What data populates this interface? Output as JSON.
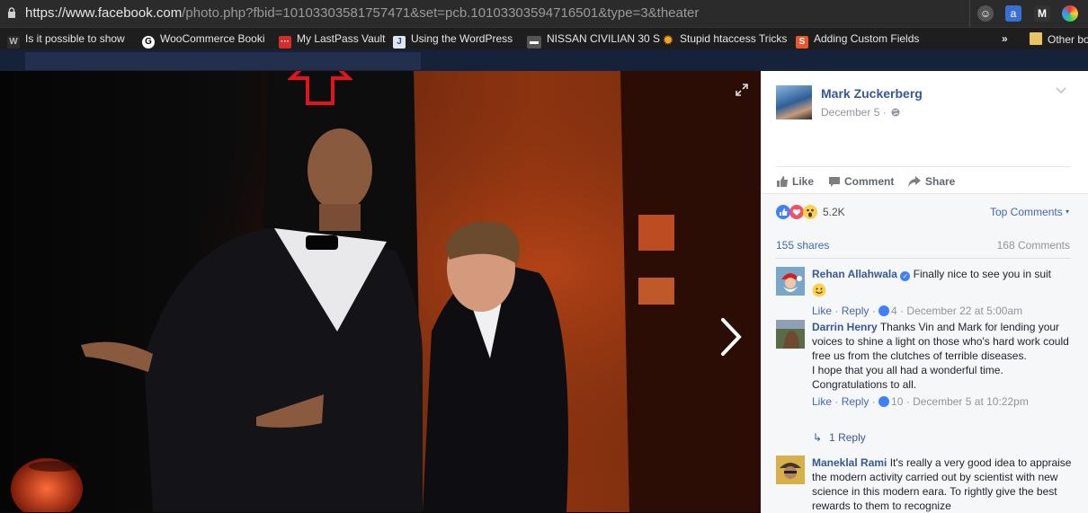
{
  "browser": {
    "url_host": "https://www.facebook.com",
    "url_path": "/photo.php?fbid=10103303581757471&set=pcb.10103303594716501&type=3&theater",
    "bookmarks": [
      {
        "label": "Is it possible to show",
        "icon": "wordpress-icon"
      },
      {
        "label": "WooCommerce Booki",
        "icon": "github-icon"
      },
      {
        "label": "My LastPass Vault",
        "icon": "lastpass-icon"
      },
      {
        "label": "Using the WordPress",
        "icon": "j-doc-icon"
      },
      {
        "label": "NISSAN CIVILIAN 30 S",
        "icon": "nissan-icon"
      },
      {
        "label": "Stupid htaccess Tricks",
        "icon": "sun-icon"
      },
      {
        "label": "Adding Custom Fields",
        "icon": "s-icon"
      },
      {
        "label": "»",
        "icon": "more-icon"
      },
      {
        "label": "Other bo",
        "icon": "folder-icon"
      }
    ]
  },
  "post": {
    "author": "Mark Zuckerberg",
    "date": "December 5 ·",
    "actions": {
      "like": "Like",
      "comment": "Comment",
      "share": "Share"
    },
    "reaction_count": "5.2K",
    "top_comments": "Top Comments",
    "shares": "155 shares",
    "comment_count": "168 Comments"
  },
  "comments": [
    {
      "author": "Rehan Allahwala",
      "text": "Finally nice to see you in suit",
      "like": "Like",
      "reply": "Reply",
      "likes": "4",
      "time": "December 22 at 5:00am"
    },
    {
      "author": "Darrin Henry",
      "text": "Thanks Vin and Mark for lending your voices to shine a light on those who's hard work could free us from the clutches of terrible diseases.",
      "text2": "I hope that you all had a wonderful time.",
      "text3": "Congratulations to all.",
      "like": "Like",
      "reply": "Reply",
      "likes": "10",
      "time": "December 5 at 10:22pm",
      "reply_link": "1 Reply"
    },
    {
      "author": "Maneklal Rami",
      "text": "It's really a very good idea to appraise the modern activity carried out by scientist with new science in this modern eara. To rightly give the best rewards to them to recognize"
    }
  ],
  "colors": {
    "fb_link": "#365899",
    "annotation_red": "#e3141c"
  }
}
